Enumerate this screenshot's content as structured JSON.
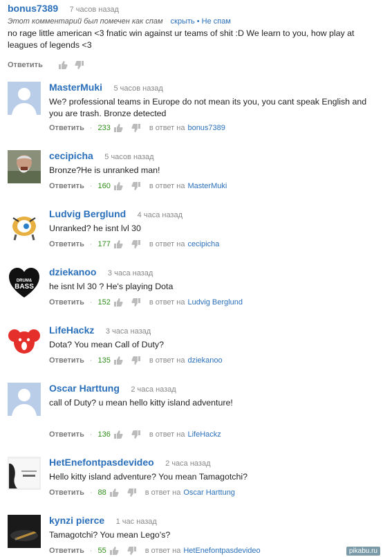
{
  "first_comment": {
    "author": "bonus7389",
    "time": "7 часов назад",
    "spam_notice": "Этот комментарий был помечен как спам",
    "hide_link": "скрыть",
    "not_spam_link": "Не спам",
    "text": "no rage little american <3 fnatic win against ur teams of shit :D We learn to you, how play at leagues of legends <3",
    "reply_label": "Ответить"
  },
  "reply_prefix": "в ответ на",
  "comments": [
    {
      "author": "MasterMuki",
      "time": "5 часов назад",
      "text": "We? professional teams in Europe do not mean its you, you cant speak English and you are trash. Bronze detected",
      "reply_label": "Ответить",
      "likes": "233",
      "reply_to": "bonus7389",
      "avatar": "default"
    },
    {
      "author": "cecipicha",
      "time": "5 часов назад",
      "text": "Bronze?He is unranked man!",
      "reply_label": "Ответить",
      "likes": "160",
      "reply_to": "MasterMuki",
      "avatar": "photo"
    },
    {
      "author": "Ludvig Berglund",
      "time": "4 часа назад",
      "text": "Unranked? he isnt lvl 30",
      "reply_label": "Ответить",
      "likes": "177",
      "reply_to": "cecipicha",
      "avatar": "robot"
    },
    {
      "author": "dziekanoo",
      "time": "3 часа назад",
      "text": "he isnt lvl 30 ? He's playing Dota",
      "reply_label": "Ответить",
      "likes": "152",
      "reply_to": "Ludvig Berglund",
      "avatar": "heart",
      "avatar_text_1": "DRUM&",
      "avatar_text_2": "BASS"
    },
    {
      "author": "LifeHackz",
      "time": "3 часа назад",
      "text": "Dota? You mean Call of Duty?",
      "reply_label": "Ответить",
      "likes": "135",
      "reply_to": "dziekanoo",
      "avatar": "koala"
    },
    {
      "author": "Oscar Harttung",
      "time": "2 часа назад",
      "text": "call of Duty? u mean hello kitty island adventure!",
      "reply_label": "Ответить",
      "likes": "136",
      "reply_to": "LifeHackz",
      "avatar": "default"
    },
    {
      "author": "HetEnefontpasdevideo",
      "time": "2 часа назад",
      "text": "Hello kitty island adventure? You mean Tamagotchi?",
      "reply_label": "Ответить",
      "likes": "88",
      "reply_to": "Oscar Harttung",
      "avatar": "dark"
    },
    {
      "author": "kynzi pierce",
      "time": "1 час назад",
      "text": "Tamagotchi? You mean Lego's?",
      "reply_label": "Ответить",
      "likes": "55",
      "reply_to": "HetEnefontpasdevideo",
      "avatar": "blade"
    }
  ],
  "watermark": "pikabu.ru",
  "colors": {
    "link": "#2a6fba",
    "likes": "#2f8f1a",
    "meta": "#888888"
  }
}
